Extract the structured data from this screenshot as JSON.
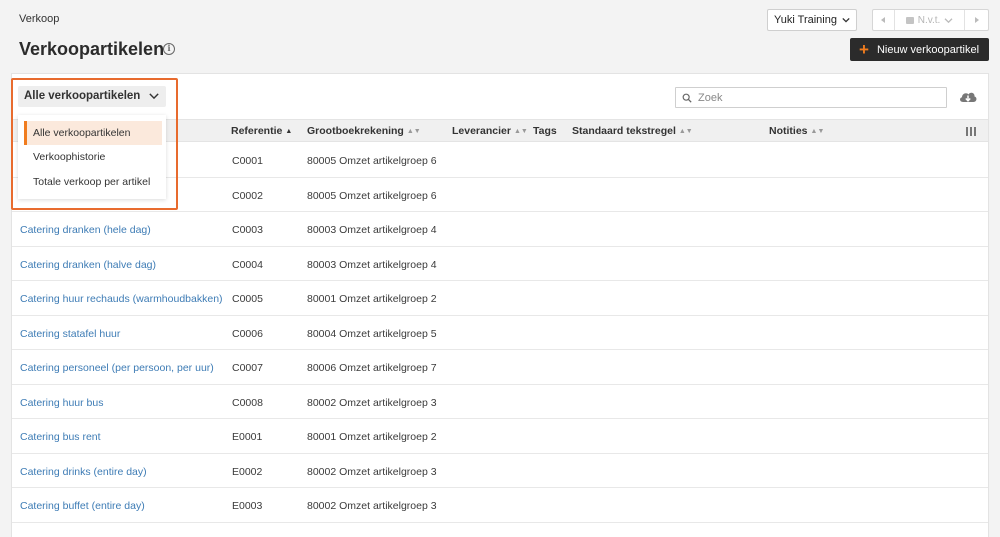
{
  "breadcrumb": "Verkoop",
  "page_title": "Verkoopartikelen",
  "info_icon": "info-icon",
  "company_select": {
    "value": "Yuki Training"
  },
  "period": {
    "label": "N.v.t."
  },
  "new_button": {
    "label": "Nieuw verkoopartikel"
  },
  "filter": {
    "selected": "Alle verkoopartikelen",
    "options": [
      "Alle verkoopartikelen",
      "Verkoophistorie",
      "Totale verkoop per artikel"
    ]
  },
  "search": {
    "placeholder": "Zoek",
    "value": ""
  },
  "colors": {
    "accent": "#f07c1e",
    "link": "#3e7cb5",
    "highlight": "#e86b2e"
  },
  "columns": [
    "Referentie",
    "Grootboekrekening",
    "Leverancier",
    "Tags",
    "Standaard tekstregel",
    "Notities"
  ],
  "rows": [
    {
      "name": "",
      "ref": "C0001",
      "ledger": "80005 Omzet artikelgroep 6"
    },
    {
      "name": "",
      "ref": "C0002",
      "ledger": "80005 Omzet artikelgroep 6"
    },
    {
      "name": "Catering dranken (hele dag)",
      "ref": "C0003",
      "ledger": "80003 Omzet artikelgroep 4"
    },
    {
      "name": "Catering dranken (halve dag)",
      "ref": "C0004",
      "ledger": "80003 Omzet artikelgroep 4"
    },
    {
      "name": "Catering huur rechauds (warmhoudbakken)",
      "ref": "C0005",
      "ledger": "80001 Omzet artikelgroep 2"
    },
    {
      "name": "Catering statafel huur",
      "ref": "C0006",
      "ledger": "80004 Omzet artikelgroep 5"
    },
    {
      "name": "Catering personeel (per persoon, per uur)",
      "ref": "C0007",
      "ledger": "80006 Omzet artikelgroep 7"
    },
    {
      "name": "Catering huur bus",
      "ref": "C0008",
      "ledger": "80002 Omzet artikelgroep 3"
    },
    {
      "name": "Catering bus rent",
      "ref": "E0001",
      "ledger": "80001 Omzet artikelgroep 2"
    },
    {
      "name": "Catering drinks (entire day)",
      "ref": "E0002",
      "ledger": "80002 Omzet artikelgroep 3"
    },
    {
      "name": "Catering buffet (entire day)",
      "ref": "E0003",
      "ledger": "80002 Omzet artikelgroep 3"
    }
  ]
}
